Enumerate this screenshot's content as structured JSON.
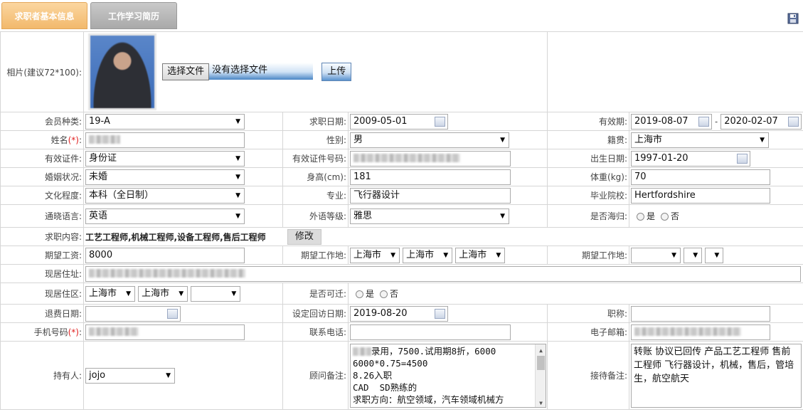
{
  "tabs": [
    {
      "label": "求职者基本信息"
    },
    {
      "label": "工作学习简历"
    }
  ],
  "toolbar": {
    "save_icon": "save-icon"
  },
  "photo": {
    "label": "相片(建议72*100):",
    "choose_file_label": "选择文件",
    "file_status": "没有选择文件",
    "upload_label": "上传"
  },
  "fields": {
    "member_type": {
      "label": "会员种类:",
      "value": "19-A"
    },
    "job_date": {
      "label": "求职日期:",
      "value": "2009-05-01"
    },
    "valid_period": {
      "label": "有效期:",
      "start": "2019-08-07",
      "sep": "-",
      "end": "2020-02-07"
    },
    "name": {
      "label": "姓名",
      "required": "(*)",
      "suffix": ":"
    },
    "gender": {
      "label": "性别:",
      "value": "男"
    },
    "native_place": {
      "label": "籍贯:",
      "value": "上海市"
    },
    "id_type": {
      "label": "有效证件:",
      "value": "身份证"
    },
    "id_number": {
      "label": "有效证件号码:"
    },
    "birth_date": {
      "label": "出生日期:",
      "value": "1997-01-20"
    },
    "marital": {
      "label": "婚姻状况:",
      "value": "未婚"
    },
    "height": {
      "label": "身高(cm):",
      "value": "181"
    },
    "weight": {
      "label": "体重(kg):",
      "value": "70"
    },
    "education": {
      "label": "文化程度:",
      "value": "本科（全日制）"
    },
    "major": {
      "label": "专业:",
      "value": "飞行器设计"
    },
    "school": {
      "label": "毕业院校:",
      "value": "Hertfordshire"
    },
    "language": {
      "label": "通晓语言:",
      "value": "英语"
    },
    "foreign_level": {
      "label": "外语等级:",
      "value": "雅思"
    },
    "returnee": {
      "label": "是否海归:",
      "yes": "是",
      "no": "否"
    },
    "job_content": {
      "label": "求职内容:",
      "value": "工艺工程师,机械工程师,设备工程师,售后工程师",
      "edit_label": "修改"
    },
    "salary": {
      "label": "期望工资:",
      "value": "8000"
    },
    "work_place": {
      "label": "期望工作地:",
      "values": [
        "上海市",
        "上海市",
        "上海市"
      ]
    },
    "work_place2": {
      "label": "期望工作地:"
    },
    "address": {
      "label": "现居住址:"
    },
    "district": {
      "label": "现居住区:",
      "values": [
        "上海市",
        "上海市",
        ""
      ]
    },
    "relocate": {
      "label": "是否可迁:",
      "yes": "是",
      "no": "否"
    },
    "refund_date": {
      "label": "退费日期:"
    },
    "revisit_date": {
      "label": "设定回访日期:",
      "value": "2019-08-20"
    },
    "title": {
      "label": "职称:"
    },
    "mobile": {
      "label": "手机号码",
      "required": "(*)",
      "suffix": ":"
    },
    "phone": {
      "label": "联系电话:"
    },
    "email": {
      "label": "电子邮箱:"
    },
    "holder": {
      "label": "持有人:",
      "value": "jojo"
    },
    "consultant_note": {
      "label": "顾问备注:",
      "lines": [
        "录用，7500.试用期8折，6000",
        "6000*0.75=4500",
        "8.26入职",
        "CAD  SD熟练的",
        "求职方向：航空领域，汽车领域机械方"
      ]
    },
    "reception_note": {
      "label": "接待备注:",
      "value": "转账  协议已回传  产品工艺工程师  售前工程师  飞行器设计，机械，售后，管培生，航空航天"
    }
  }
}
